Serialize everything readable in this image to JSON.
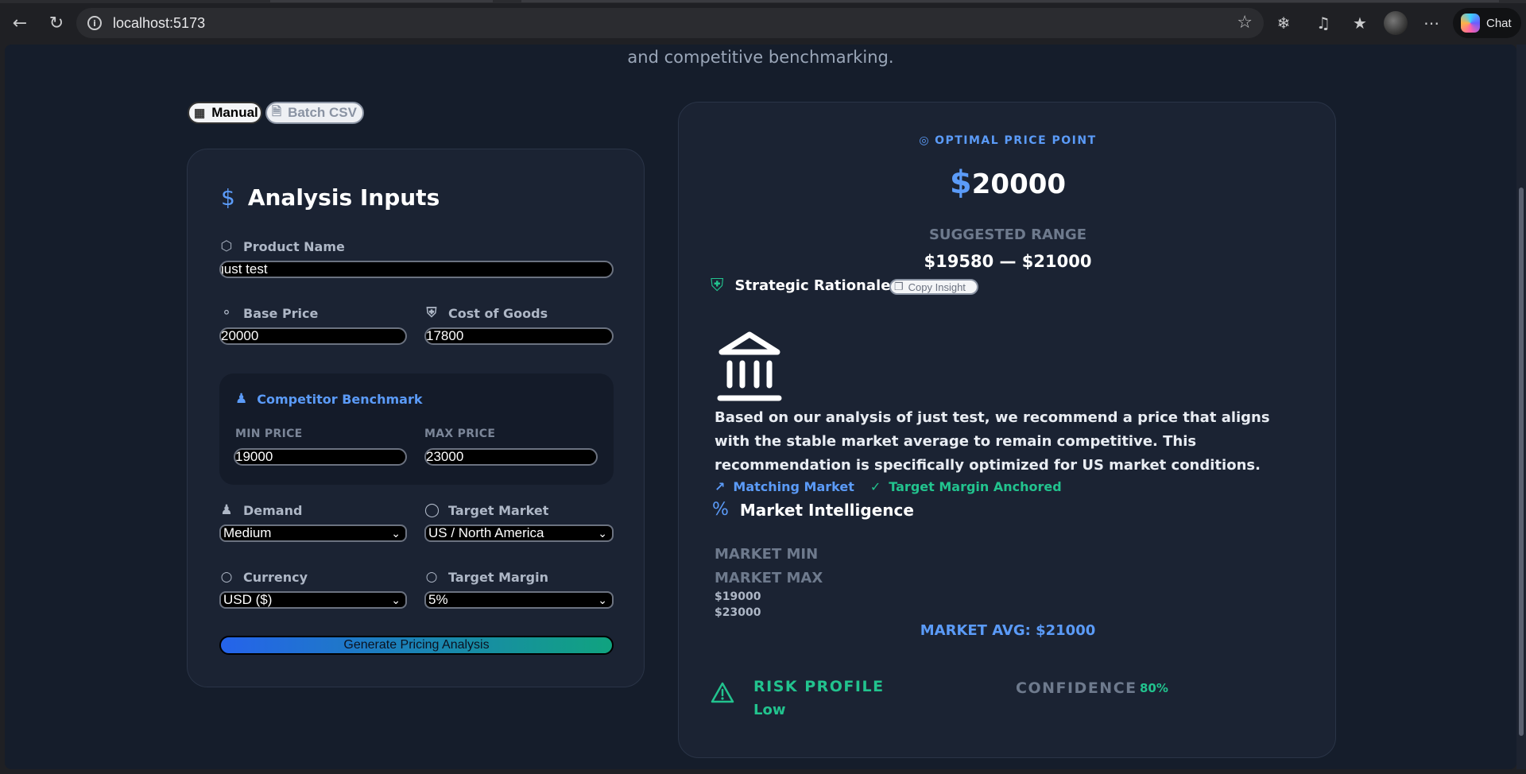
{
  "browser": {
    "url": "localhost:5173",
    "chat_label": "Chat"
  },
  "page": {
    "subtitle": "and competitive benchmarking."
  },
  "mode_toggle": {
    "manual_label": "Manual",
    "batch_label": "Batch CSV"
  },
  "inputs": {
    "title": "Analysis Inputs",
    "product_name_label": "Product Name",
    "product_name_value": "just test",
    "base_price_label": "Base Price",
    "base_price_value": "20000",
    "cost_label": "Cost of Goods",
    "cost_value": "17800",
    "benchmark_title": "Competitor Benchmark",
    "min_price_label": "MIN PRICE",
    "min_price_value": "19000",
    "max_price_label": "MAX PRICE",
    "max_price_value": "23000",
    "demand_label": "Demand",
    "demand_value": "Medium",
    "market_label": "Target Market",
    "market_value": "US / North America",
    "currency_label": "Currency",
    "currency_value": "USD ($)",
    "margin_label": "Target Margin",
    "margin_value": "5%",
    "generate_label": "Generate Pricing Analysis"
  },
  "result": {
    "optimal_label": "OPTIMAL PRICE POINT",
    "currency_symbol": "$",
    "optimal_price": "20000",
    "range_label": "SUGGESTED RANGE",
    "range_value": "$19580 — $21000",
    "rationale_title": "Strategic Rationale",
    "copy_label": "Copy Insight",
    "rationale_text": "Based on our analysis of just test, we recommend a price that aligns with the stable market average to remain competitive. This recommendation is specifically optimized for US market conditions.",
    "tag_market": "Matching Market",
    "tag_margin": "Target Margin Anchored",
    "intel_title": "Market Intelligence",
    "market_min_label": "MARKET MIN",
    "market_max_label": "MARKET MAX",
    "market_min_value": "$19000",
    "market_max_value": "$23000",
    "market_avg": "MARKET AVG: $21000",
    "risk_label": "RISK PROFILE",
    "risk_value": "Low",
    "confidence_label": "CONFIDENCE",
    "confidence_value": "80%"
  },
  "colors": {
    "accent_blue": "#5b9bf8",
    "accent_green": "#22c38e",
    "card_bg": "#1b2333",
    "page_bg": "#151d2b"
  }
}
